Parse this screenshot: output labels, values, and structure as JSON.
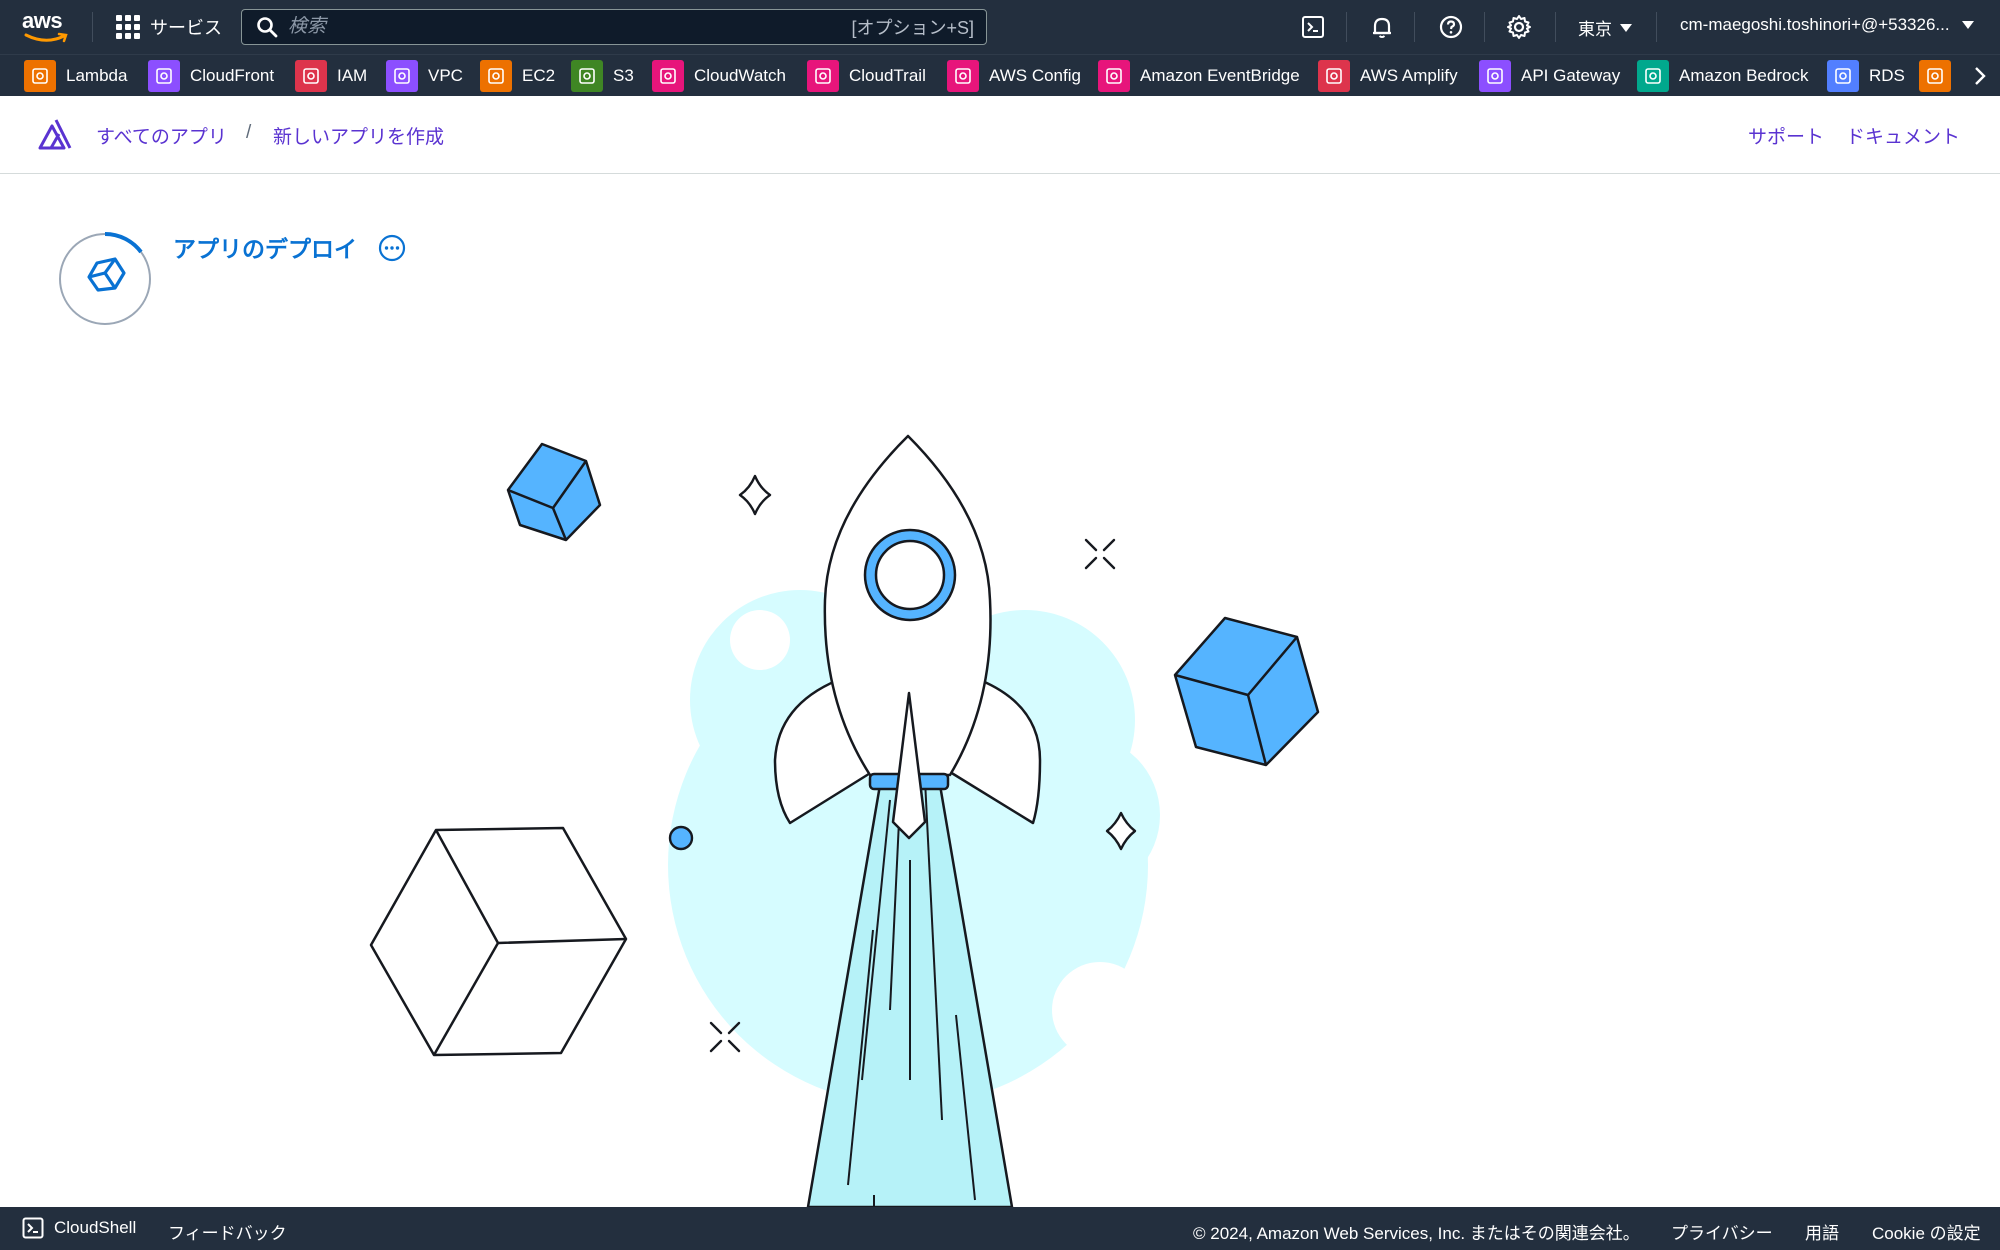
{
  "topnav": {
    "logo_text": "aws",
    "services_label": "サービス",
    "search_placeholder": "検索",
    "search_shortcut": "[オプション+S]",
    "icons": [
      "cloudshell-icon",
      "bell-icon",
      "help-icon",
      "settings-icon"
    ],
    "region": "東京",
    "account": "cm-maegoshi.toshinori+@+53326..."
  },
  "favorites": [
    {
      "label": "Lambda",
      "color": "#ed7100",
      "icon": "lambda-icon"
    },
    {
      "label": "CloudFront",
      "color": "#8c4fff",
      "icon": "cloudfront-icon"
    },
    {
      "label": "IAM",
      "color": "#dd344c",
      "icon": "iam-icon"
    },
    {
      "label": "VPC",
      "color": "#8c4fff",
      "icon": "vpc-icon"
    },
    {
      "label": "EC2",
      "color": "#ed7100",
      "icon": "ec2-icon"
    },
    {
      "label": "S3",
      "color": "#3f8624",
      "icon": "s3-icon"
    },
    {
      "label": "CloudWatch",
      "color": "#e7157b",
      "icon": "cloudwatch-icon"
    },
    {
      "label": "CloudTrail",
      "color": "#e7157b",
      "icon": "cloudtrail-icon"
    },
    {
      "label": "AWS Config",
      "color": "#e7157b",
      "icon": "config-icon"
    },
    {
      "label": "Amazon EventBridge",
      "color": "#e7157b",
      "icon": "eventbridge-icon"
    },
    {
      "label": "AWS Amplify",
      "color": "#dd344c",
      "icon": "amplify-icon"
    },
    {
      "label": "API Gateway",
      "color": "#8c4fff",
      "icon": "api-gateway-icon"
    },
    {
      "label": "Amazon Bedrock",
      "color": "#01a88d",
      "icon": "bedrock-icon"
    },
    {
      "label": "RDS",
      "color": "#527fff",
      "icon": "rds-icon"
    },
    {
      "label": "",
      "color": "#ed7100",
      "icon": "service-icon"
    }
  ],
  "amplify_header": {
    "breadcrumb_all_apps": "すべてのアプリ",
    "breadcrumb_separator": "/",
    "breadcrumb_current": "新しいアプリを作成",
    "support": "サポート",
    "documents": "ドキュメント"
  },
  "deploy": {
    "title": "アプリのデプロイ",
    "status": "in-progress",
    "colors": {
      "accent": "#0972d3",
      "cube_blue": "#55b4ff",
      "glow": "#d6fcff"
    }
  },
  "footer": {
    "cloudshell": "CloudShell",
    "feedback": "フィードバック",
    "copyright": "© 2024, Amazon Web Services, Inc. またはその関連会社。",
    "privacy": "プライバシー",
    "terms": "用語",
    "cookie": "Cookie の設定"
  }
}
